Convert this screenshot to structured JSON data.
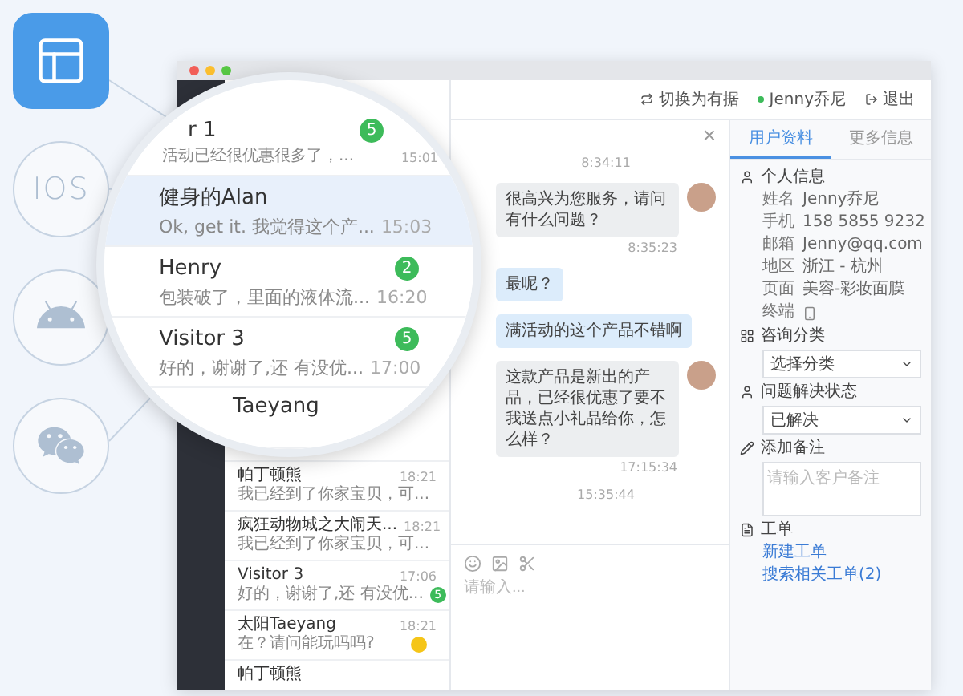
{
  "platforms": [
    {
      "kind": "web",
      "selected": true
    },
    {
      "kind": "ios",
      "label": "IOS",
      "selected": false
    },
    {
      "kind": "android",
      "selected": false
    },
    {
      "kind": "wechat",
      "selected": false
    }
  ],
  "toolbar": {
    "switch_label": "切换为有据",
    "agent": "Jenny乔尼",
    "logout": "退出"
  },
  "magnifier": {
    "conversations": [
      {
        "name": "r 1",
        "preview": "活动已经很优惠很多了，...",
        "time": "15:01",
        "badge": "5",
        "selected": false
      },
      {
        "name": "健身的Alan",
        "preview": "Ok, get it. 我觉得这个产...",
        "time": "15:03",
        "selected": true
      },
      {
        "name": "Henry",
        "preview": "包装破了，里面的液体流...",
        "time": "16:20",
        "badge": "2",
        "selected": false
      },
      {
        "name": "Visitor 3",
        "preview": "好的，谢谢了,还 有没优...",
        "time": "17:00",
        "badge": "5",
        "selected": false
      },
      {
        "name": "Taeyang",
        "selected": false
      }
    ]
  },
  "conversations": [
    {
      "name": "帕丁顿熊",
      "preview": "我已经到了你家宝贝，可...",
      "time": "18:21"
    },
    {
      "name": "疯狂动物城之大闹天...",
      "preview": "我已经到了你家宝贝，可...",
      "time": "18:21"
    },
    {
      "name": "Visitor 3",
      "preview": "好的，谢谢了,还 有没优...",
      "time": "17:06",
      "badge": "5"
    },
    {
      "name": "太阳Taeyang",
      "preview": "在？请问能玩吗吗?",
      "time": "18:21",
      "emoji": true
    },
    {
      "name": "帕丁顿熊"
    }
  ],
  "chat": {
    "close": "×",
    "input_placeholder": "请输入...",
    "messages": [
      {
        "kind": "time",
        "text": "8:34:11"
      },
      {
        "kind": "agent",
        "text": "很高兴为您服务，请问有什么问题？",
        "time": "8:35:23"
      },
      {
        "kind": "visitor",
        "text": "最呢？"
      },
      {
        "kind": "visitor",
        "text": "满活动的这个产品不错啊"
      },
      {
        "kind": "agent",
        "text": "这款产品是新出的产品，已经很优惠了要不我送点小礼品给你，怎么样？",
        "time": "17:15:34"
      },
      {
        "kind": "time",
        "text": "15:35:44"
      }
    ]
  },
  "profile": {
    "tabs": [
      {
        "label": "用户资料",
        "selected": true
      },
      {
        "label": "更多信息",
        "selected": false
      }
    ],
    "info_title": "个人信息",
    "fields": [
      {
        "kind": "text",
        "label": "姓名",
        "value": "Jenny乔尼"
      },
      {
        "kind": "text",
        "label": "手机",
        "value": "158 5855 9232"
      },
      {
        "kind": "text",
        "label": "邮箱",
        "value": "Jenny@qq.com"
      },
      {
        "kind": "text",
        "label": "地区",
        "value": "浙江 - 杭州"
      },
      {
        "kind": "text",
        "label": "页面",
        "value": "美容-彩妆面膜"
      },
      {
        "kind": "device",
        "label": "终端"
      }
    ],
    "category_title": "咨询分类",
    "category_value": "选择分类",
    "status_title": "问题解决状态",
    "status_value": "已解决",
    "note_title": "添加备注",
    "note_placeholder": "请输入客户备注",
    "ticket_title": "工单",
    "ticket_links": [
      "新建工单",
      "搜索相关工单(2)"
    ]
  }
}
